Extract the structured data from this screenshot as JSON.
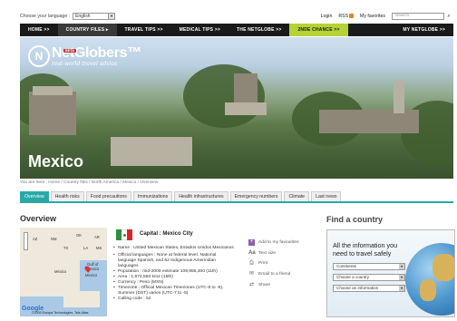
{
  "topbar": {
    "language_label": "Choose your language :",
    "language_value": "English",
    "login": "Login",
    "rss": "RSS",
    "favorites": "My favorites",
    "search_placeholder": "Search"
  },
  "nav": {
    "items": [
      {
        "label": "HOME >>"
      },
      {
        "label": "COUNTRY FILES ▸"
      },
      {
        "label": "TRAVEL TIPS >>"
      },
      {
        "label": "MEDICAL TIPS >>"
      },
      {
        "label": "THE NETGLOBE >>"
      },
      {
        "label": "2NDE CHANCE >>"
      },
      {
        "label": "MY NETGLOBE >>"
      }
    ]
  },
  "hero": {
    "logo_name": "NetGlobers™",
    "logo_tagline": "real-world travel advice",
    "beta": "BETA",
    "country": "Mexico"
  },
  "breadcrumb": "You are here : Home / Country files / North America / Mexico / Overview",
  "tabs": [
    {
      "label": "Overview"
    },
    {
      "label": "Health risks"
    },
    {
      "label": "Food precautions"
    },
    {
      "label": "Immunizations"
    },
    {
      "label": "Health infrastructures"
    },
    {
      "label": "Emergency numbers"
    },
    {
      "label": "Climate"
    },
    {
      "label": "Last news"
    }
  ],
  "overview": {
    "title": "Overview",
    "capital": "Capital : Mexico City",
    "facts": [
      "Name : United Mexican States, Estados Unidos Mexicanos",
      "Official languages : None at federal level. National language Spanish, and 62 Indigenous Amerindian languages",
      "Population : mid-2009 estimate 109,955,400 (11th)",
      "Area : 1,972,550 km2 (15th)",
      "Currency : Peso (MXN)",
      "Timezone : Official Mexican Timezones (UTC-8 to -6), Summer (DST) varies (UTC-7 to -5)",
      "Calling code : 52"
    ]
  },
  "map": {
    "labels": [
      "AZ",
      "NM",
      "TX",
      "OK",
      "AR",
      "LA",
      "MS",
      "Gulf of Mexico",
      "México",
      "Mexico"
    ],
    "google": "Google",
    "attribution": "©2009 Europa Technologies, Tele Atlas"
  },
  "tools": [
    {
      "icon": "plus-icon",
      "label": "Add to my favourites"
    },
    {
      "icon": "text-size-icon",
      "label": "Text size"
    },
    {
      "icon": "print-icon",
      "label": "Print"
    },
    {
      "icon": "email-icon",
      "label": "Email to a friend"
    },
    {
      "icon": "share-icon",
      "label": "Share"
    }
  ],
  "find": {
    "title": "Find a country",
    "text": "All the information you need to travel safely",
    "selects": [
      "Continents",
      "Choose a country",
      "Choose an information"
    ]
  },
  "colors": {
    "nav_bg": "#1a1a1a",
    "accent_teal": "#2aa8a8",
    "zinde_green": "#b5d334"
  }
}
